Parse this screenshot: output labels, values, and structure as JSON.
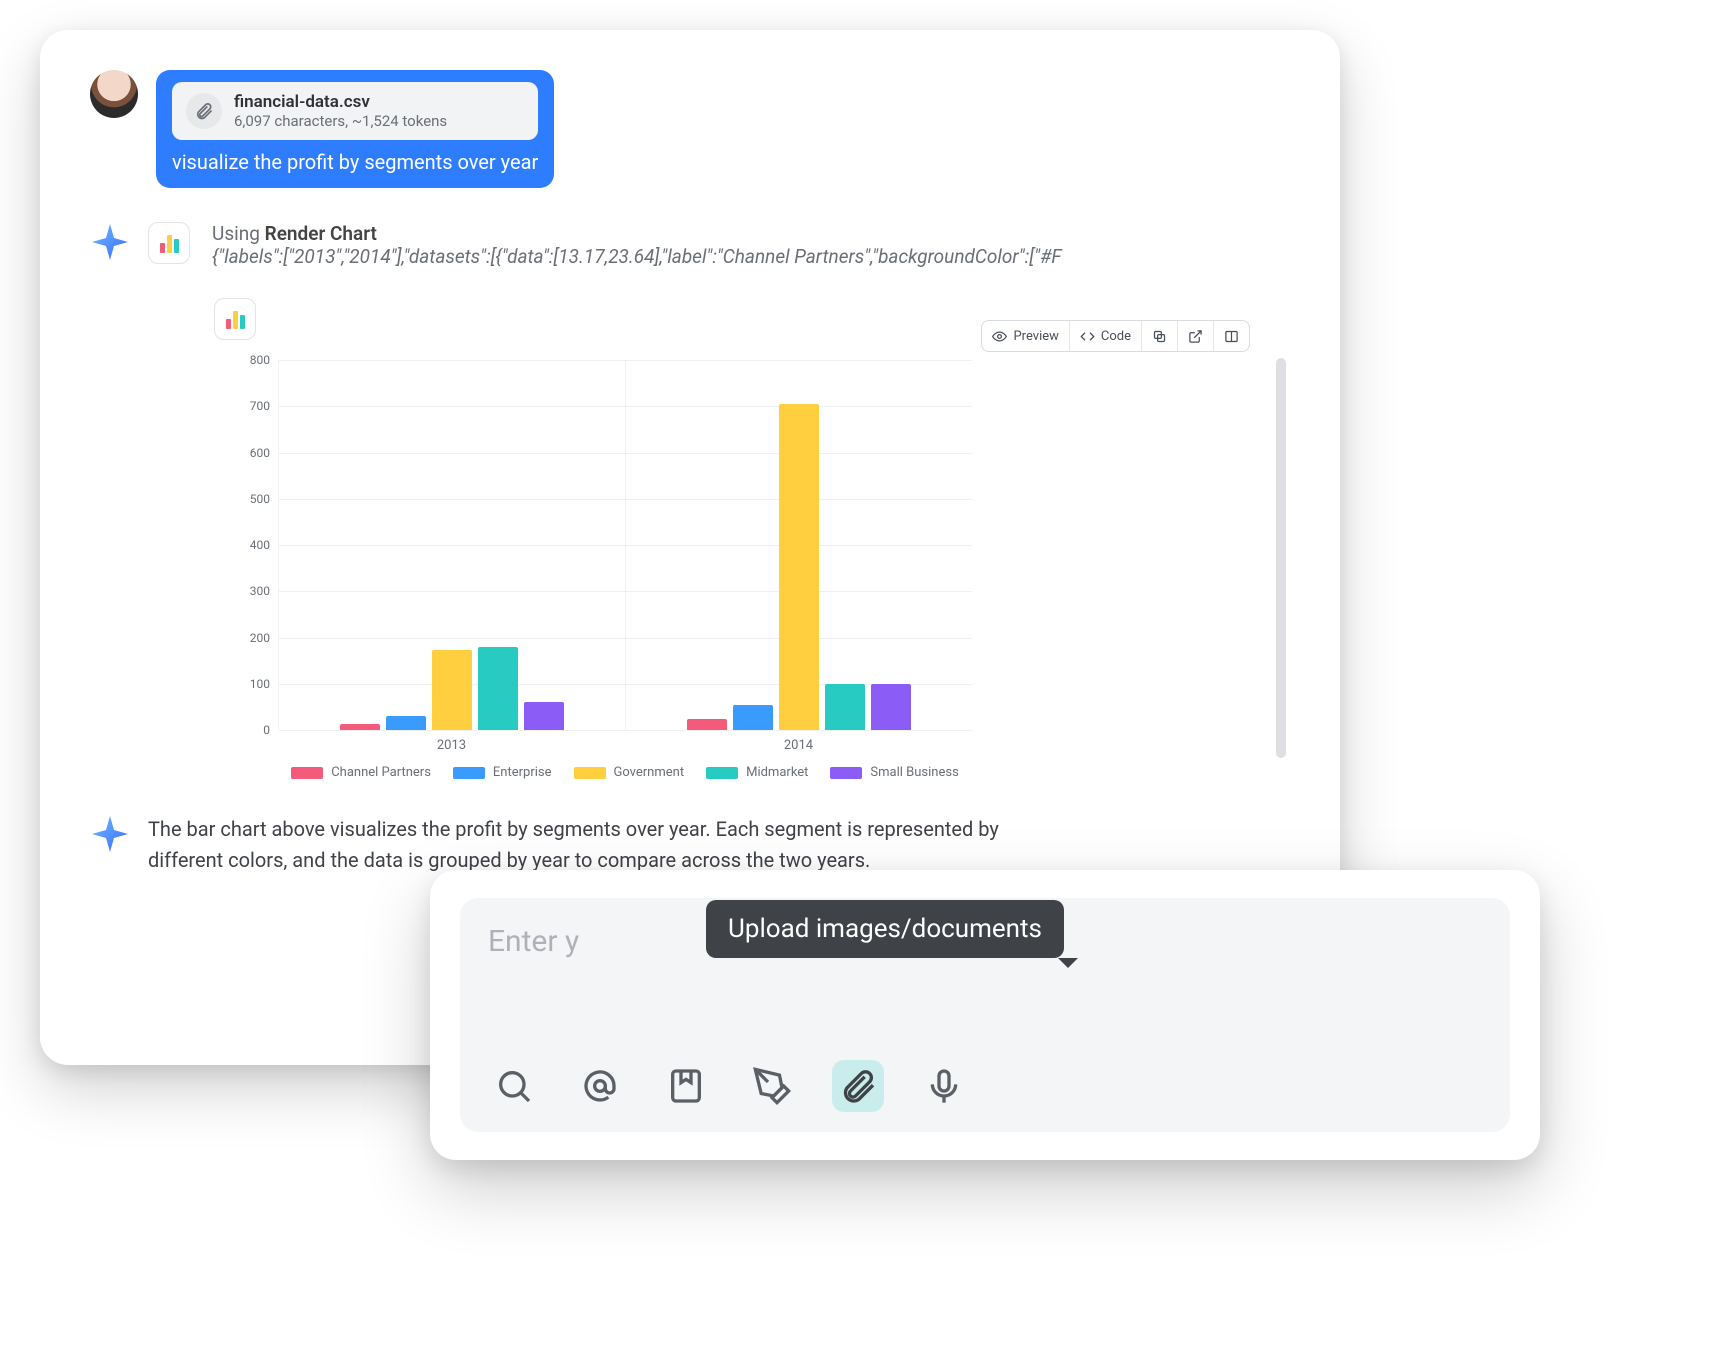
{
  "user": {
    "attachment": {
      "filename": "financial-data.csv",
      "meta": "6,097 characters, ~1,524 tokens"
    },
    "message": "visualize the profit by segments over year"
  },
  "assistant": {
    "tool_line_prefix": "Using ",
    "tool_name": "Render Chart",
    "tool_json": "{\"labels\":[\"2013\",\"2014\"],\"datasets\":[{\"data\":[13.17,23.64],\"label\":\"Channel Partners\",\"backgroundColor\":[\"#F",
    "response_text": "The bar chart above visualizes the profit by segments over year. Each segment is represented by different colors, and the data is grouped by year to compare across the two years."
  },
  "chart_toolbar": {
    "preview": "Preview",
    "code": "Code"
  },
  "chart_data": {
    "type": "bar",
    "categories": [
      "2013",
      "2014"
    ],
    "series": [
      {
        "name": "Channel Partners",
        "color": "#f45b7a",
        "values": [
          13.17,
          23.64
        ]
      },
      {
        "name": "Enterprise",
        "color": "#3a9bff",
        "values": [
          30,
          55
        ]
      },
      {
        "name": "Government",
        "color": "#ffcf3f",
        "values": [
          172,
          705
        ]
      },
      {
        "name": "Midmarket",
        "color": "#28cbc2",
        "values": [
          180,
          100
        ]
      },
      {
        "name": "Small Business",
        "color": "#8b5cf6",
        "values": [
          60,
          100
        ]
      }
    ],
    "ylim": [
      0,
      800
    ],
    "ytick_step": 100,
    "xlabel": "",
    "ylabel": ""
  },
  "input": {
    "placeholder": "Enter your message...",
    "placeholder_visible": "Enter y",
    "tooltip": "Upload images/documents"
  },
  "colors": {
    "accent": "#2f7dff",
    "tooltip_bg": "#3f4246",
    "active_tool_bg": "#c9edec"
  }
}
